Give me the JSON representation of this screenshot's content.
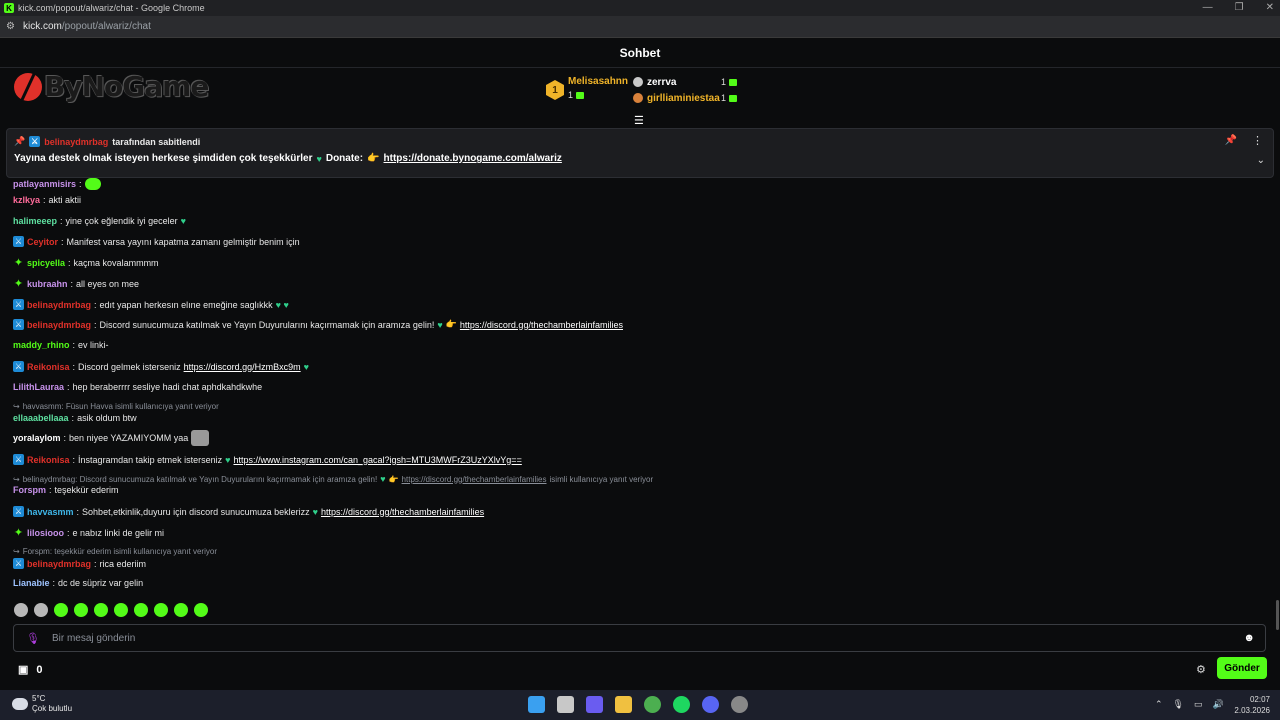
{
  "browser": {
    "window_title": "kick.com/popout/alwariz/chat - Google Chrome",
    "url_host": "kick.com",
    "url_path": "/popout/alwariz/chat"
  },
  "chat": {
    "header_title": "Sohbet",
    "logo_text": "ByNoGame",
    "leaderboard": {
      "first": {
        "rank": "1",
        "name": "Melisasahnn",
        "count": "1"
      },
      "others": [
        {
          "name": "zerrva",
          "count": "1",
          "color": "#ffffff"
        },
        {
          "name": "girlliaminiestaa",
          "count": "1",
          "color": "#f0b429"
        }
      ]
    },
    "pinned": {
      "pinned_by": "belinaydmrbag",
      "pinned_suffix": "tarafından sabitlendi",
      "message": "Yayına destek olmak isteyen herkese şimdiden çok teşekkürler",
      "donate_label": "Donate:",
      "link": "https://donate.bynogame.com/alwariz"
    },
    "messages": [
      {
        "user": "patlayanmisirs",
        "color": "#c792ea",
        "text": ""
      },
      {
        "user": "kzlkya",
        "color": "#ff6b9a",
        "text": "akti aktii"
      },
      {
        "user": "halimeeep",
        "color": "#5ee0a0",
        "text": "yine çok eğlendik iyi geceler"
      },
      {
        "user": "Ceyitor",
        "color": "#e0312a",
        "text": "Manifest varsa yayını kapatma zamanı gelmiştir benim için"
      },
      {
        "user": "spicyella",
        "color": "#53fc18",
        "text": "kaçma kovalammmm"
      },
      {
        "user": "kubraahn",
        "color": "#c792ea",
        "text": "all eyes on mee"
      },
      {
        "user": "belinaydmrbag",
        "color": "#e0312a",
        "text": "edıt yapan herkesın elıne emeğine saglıkkk"
      },
      {
        "user": "belinaydmrbag",
        "color": "#e0312a",
        "text": "Discord sunucumuza katılmak ve Yayın Duyurularını kaçırmamak için aramıza gelin!",
        "link": "https://discord.gg/thechamberlainfamilies"
      },
      {
        "user": "maddy_rhino",
        "color": "#53fc18",
        "text": "ev linki-"
      },
      {
        "user": "Reikonisa",
        "color": "#e0312a",
        "text": "Discord gelmek isterseniz",
        "link": "https://discord.gg/HzmBxc9m"
      },
      {
        "user": "LilithLauraa",
        "color": "#c792ea",
        "text": "hep beraberrrr sesliye hadi chat aphdkahdkwhe"
      },
      {
        "reply": "havvasmm: Füsun Havva isimli kullanıcıya yanıt veriyor"
      },
      {
        "user": "ellaaabellaaa",
        "color": "#5ee0a0",
        "text": "asik oldum btw"
      },
      {
        "user": "yoralaylom",
        "color": "#ffffff",
        "text": "ben niyee YAZAMIYOMM yaa"
      },
      {
        "user": "Reikonisa",
        "color": "#e0312a",
        "text": "İnstagramdan takip etmek isterseniz",
        "link": "https://www.instagram.com/can_gacal?igsh=MTU3MWFrZ3UzYXlvYg=="
      },
      {
        "reply": "belinaydmrbag: Discord sunucumuza katılmak ve Yayın Duyurularını kaçırmamak için aramıza gelin!",
        "reply_link": "https://discord.gg/thechamberlainfamilies",
        "reply_suffix": "isimli kullanıcıya yanıt veriyor"
      },
      {
        "user": "Forspm",
        "color": "#c792ea",
        "text": "teşekkür ederim"
      },
      {
        "user": "havvasmm",
        "color": "#3fb6e8",
        "text": "Sohbet,etkinlik,duyuru için discord sunucumuza beklerizz",
        "link": "https://discord.gg/thechamberlainfamilies"
      },
      {
        "user": "lilosiooo",
        "color": "#c792ea",
        "text": "e nabız linki de gelir mi"
      },
      {
        "reply": "Forspm: teşekkür ederim isimli kullanıcıya yanıt veriyor"
      },
      {
        "user": "belinaydmrbag",
        "color": "#e0312a",
        "text": "rica ederiim"
      },
      {
        "user": "Lianabie",
        "color": "#9ec3ff",
        "text": "dc de süpriz var gelin"
      }
    ],
    "input_placeholder": "Bir mesaj gönderin",
    "points": "0",
    "send_label": "Gönder"
  },
  "taskbar": {
    "temperature": "5°C",
    "weather": "Çok bulutlu",
    "time": "02:07",
    "date": "2.03.2026",
    "discord_badge": "9+"
  }
}
